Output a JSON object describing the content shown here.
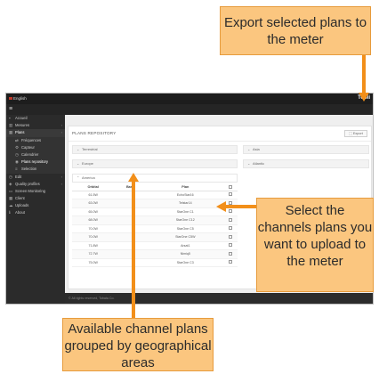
{
  "topbar": {
    "language": "English",
    "brand": "Tobii"
  },
  "sidebar": {
    "items": [
      {
        "icon": "home-icon",
        "label": "Accueil",
        "chevron": ""
      },
      {
        "icon": "chart-icon",
        "label": "Mesures",
        "chevron": "›"
      },
      {
        "icon": "map-icon",
        "label": "Plans",
        "chevron": "›",
        "active": true
      },
      {
        "icon": "channels-icon",
        "label": "Fréquences",
        "sub": true
      },
      {
        "icon": "settings-icon",
        "label": "Capteur",
        "sub": true
      },
      {
        "icon": "clock-icon",
        "label": "Calendrier",
        "sub": true
      },
      {
        "icon": "repository-icon",
        "label": "Plans repository",
        "sub": true,
        "selected": true
      },
      {
        "icon": "list-icon",
        "label": "Selection",
        "sub": true
      },
      {
        "icon": "clock-icon",
        "label": "Edit",
        "chevron": "›"
      },
      {
        "icon": "profile-icon",
        "label": "Quality profiles",
        "chevron": "›"
      },
      {
        "icon": "monitor-icon",
        "label": "Screen Monitoring"
      },
      {
        "icon": "grid-icon",
        "label": "Client"
      },
      {
        "icon": "cloud-icon",
        "label": "Uploads"
      },
      {
        "icon": "info-icon",
        "label": "About"
      }
    ]
  },
  "panel": {
    "title": "PLANS REPOSITORY",
    "export_label": "⬚ Export",
    "groups": {
      "left": [
        "Terrestrial",
        "Europe",
        "America"
      ],
      "right": [
        "Asia",
        "Atlantic"
      ]
    },
    "table": {
      "headers": [
        "Orbital",
        "Band",
        "Plan",
        ""
      ],
      "rows": [
        [
          "61.5W",
          "",
          "EchoStar16",
          ""
        ],
        [
          "63.0W",
          "",
          "Telstar14",
          ""
        ],
        [
          "65.0W",
          "",
          "StarOne C1",
          ""
        ],
        [
          "68.0W",
          "",
          "StarOne C12",
          ""
        ],
        [
          "70.0W",
          "",
          "StarOne C5",
          ""
        ],
        [
          "70.0W",
          "",
          "StarOne C5W",
          ""
        ],
        [
          "71.8W",
          "",
          "Arsat1",
          ""
        ],
        [
          "72.7W",
          "",
          "Nimiq5",
          ""
        ],
        [
          "75.0W",
          "",
          "StarOne C3",
          ""
        ]
      ]
    }
  },
  "footer": {
    "copyright": "© All rights reserved, Tobata Co."
  },
  "callouts": {
    "export": "Export selected plans to the meter",
    "select": "Select the channels plans you want to upload to the meter",
    "available": "Available channel plans grouped by geographical areas"
  },
  "colors": {
    "callout_bg": "#fbc67f",
    "arrow": "#f28f1a",
    "sidebar": "#2b2b2b"
  }
}
